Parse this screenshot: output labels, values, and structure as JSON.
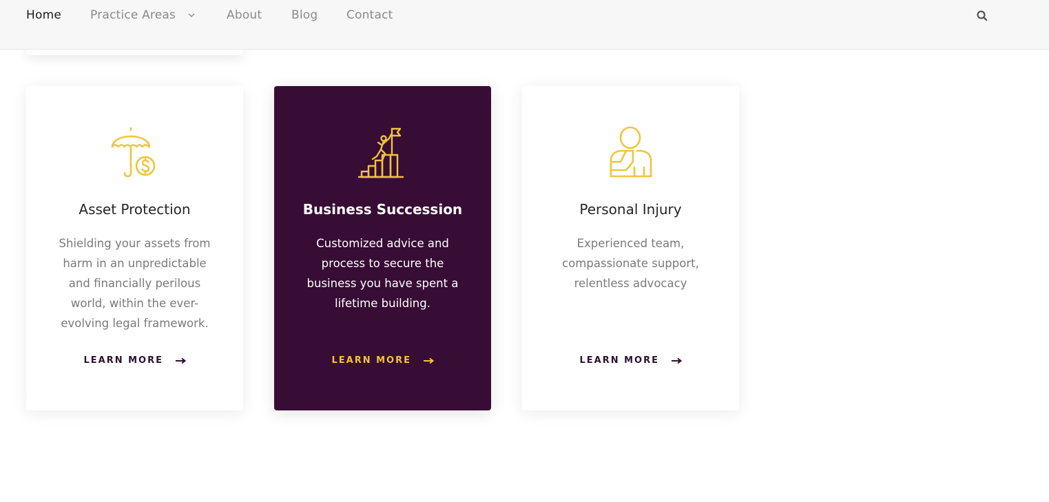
{
  "nav": {
    "items": [
      {
        "label": "Home",
        "active": true
      },
      {
        "label": "Practice Areas",
        "has_dropdown": true
      },
      {
        "label": "About"
      },
      {
        "label": "Blog"
      },
      {
        "label": "Contact"
      }
    ],
    "search_icon": "search-icon"
  },
  "colors": {
    "accent_gold": "#f0c43c",
    "featured_bg": "#370d35",
    "link_dark": "#2c1030"
  },
  "cards": [
    {
      "icon": "umbrella-dollar-icon",
      "title": "Asset Protection",
      "description": "Shielding your assets from harm in an unpredictable and financially perilous world, within the ever-evolving legal framework.",
      "link": "LEARN MORE"
    },
    {
      "icon": "climber-flag-icon",
      "title": "Business Succession",
      "description": "Customized advice and process to secure the business you have spent a lifetime building.",
      "link": "LEARN MORE"
    },
    {
      "icon": "injured-person-icon",
      "title": "Personal Injury",
      "description": "Experienced team, compassionate support, relentless advocacy",
      "link": "LEARN MORE"
    }
  ]
}
